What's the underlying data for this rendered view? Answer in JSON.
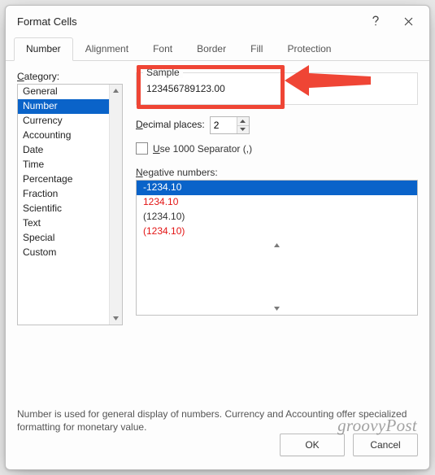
{
  "dialog": {
    "title": "Format Cells",
    "tabs": [
      "Number",
      "Alignment",
      "Font",
      "Border",
      "Fill",
      "Protection"
    ],
    "active_tab_index": 0
  },
  "category": {
    "label": "Category:",
    "items": [
      "General",
      "Number",
      "Currency",
      "Accounting",
      "Date",
      "Time",
      "Percentage",
      "Fraction",
      "Scientific",
      "Text",
      "Special",
      "Custom"
    ],
    "selected_index": 1
  },
  "sample": {
    "legend": "Sample",
    "value": "123456789123.00"
  },
  "decimal": {
    "label_pre_u": "D",
    "label_post": "ecimal places:",
    "value": "2"
  },
  "separator": {
    "label_pre_u": "U",
    "label_post": "se 1000 Separator (,)"
  },
  "negative": {
    "label_pre_u": "N",
    "label_post": "egative numbers:",
    "items": [
      {
        "text": "-1234.10",
        "red": false,
        "selected": true
      },
      {
        "text": "1234.10",
        "red": true,
        "selected": false
      },
      {
        "text": "(1234.10)",
        "red": false,
        "selected": false
      },
      {
        "text": "(1234.10)",
        "red": true,
        "selected": false
      }
    ]
  },
  "description": "Number is used for general display of numbers.  Currency and Accounting offer specialized formatting for monetary value.",
  "buttons": {
    "ok": "OK",
    "cancel": "Cancel"
  },
  "watermark": "groovyPost",
  "highlight": {
    "accent": "#ef4535"
  }
}
